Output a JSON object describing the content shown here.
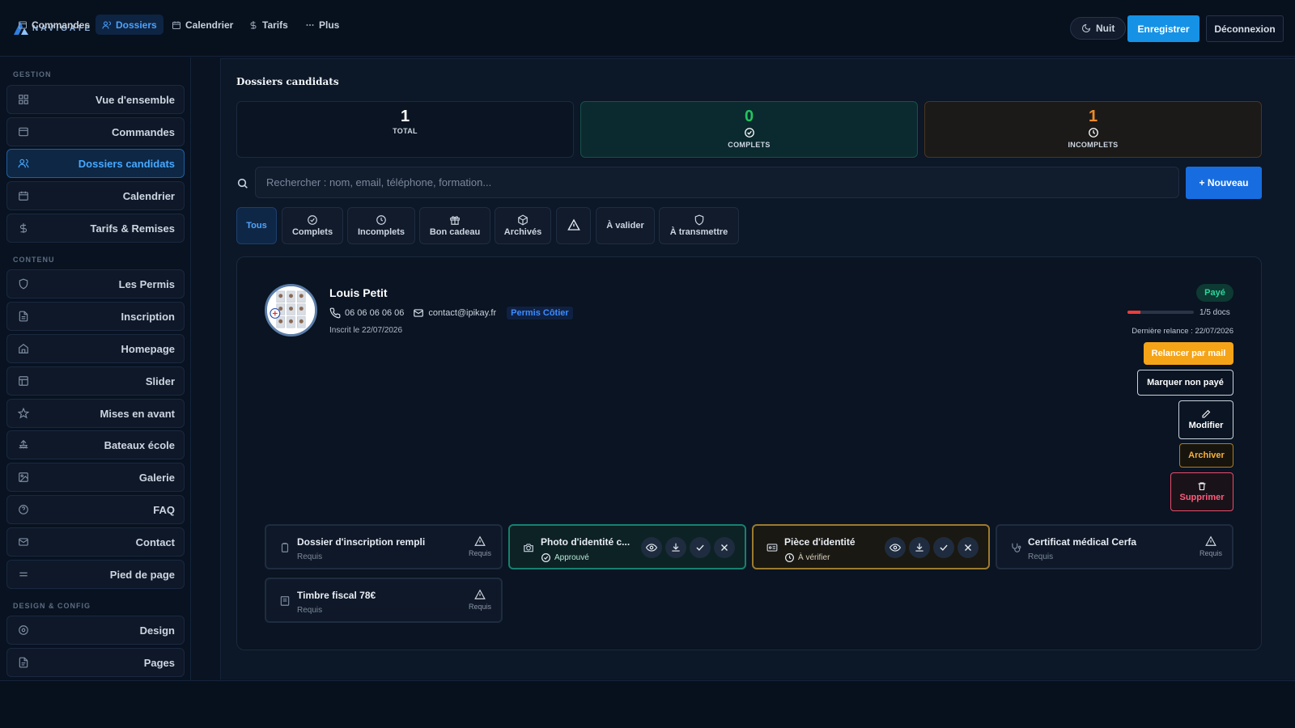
{
  "app": {
    "logo_text": "NAVIGATE"
  },
  "header": {
    "theme_label": "Nuit",
    "save_label": "Enregistrer",
    "logout_label": "Déconnexion"
  },
  "sidebar": {
    "sections": {
      "gestion": "GESTION",
      "contenu": "CONTENU",
      "design": "DESIGN & CONFIG"
    },
    "items": [
      {
        "label": "Vue d'ensemble",
        "icon": "grid-icon"
      },
      {
        "label": "Commandes",
        "icon": "box-icon"
      },
      {
        "label": "Dossiers candidats",
        "icon": "users-icon",
        "active": true
      },
      {
        "label": "Calendrier",
        "icon": "calendar-icon"
      },
      {
        "label": "Tarifs & Remises",
        "icon": "dollar-icon"
      },
      {
        "label": "Les Permis",
        "icon": "shield-icon"
      },
      {
        "label": "Inscription",
        "icon": "file-icon"
      },
      {
        "label": "Homepage",
        "icon": "home-icon"
      },
      {
        "label": "Slider",
        "icon": "layout-icon"
      },
      {
        "label": "Mises en avant",
        "icon": "star-icon"
      },
      {
        "label": "Bateaux école",
        "icon": "ship-icon"
      },
      {
        "label": "Galerie",
        "icon": "image-icon"
      },
      {
        "label": "FAQ",
        "icon": "help-icon"
      },
      {
        "label": "Contact",
        "icon": "mail-icon"
      },
      {
        "label": "Pied de page",
        "icon": "menu-icon"
      },
      {
        "label": "Design",
        "icon": "palette-icon"
      },
      {
        "label": "Pages",
        "icon": "page-icon"
      }
    ]
  },
  "main": {
    "title": "Dossiers candidats",
    "stats": {
      "total": {
        "value": "1",
        "label": "TOTAL"
      },
      "complets": {
        "value": "0",
        "label": "COMPLETS",
        "color": "#22c55e"
      },
      "incomplets": {
        "value": "1",
        "label": "INCOMPLETS",
        "color": "#f08b26"
      }
    },
    "search": {
      "placeholder": "Rechercher : nom, email, téléphone, formation...",
      "value": ""
    },
    "new_button": "+ Nouveau",
    "filters": [
      "Tous",
      "Complets",
      "Incomplets",
      "Bon cadeau",
      "Archivés",
      "",
      "À valider",
      "À transmettre"
    ],
    "candidate": {
      "name": "Louis Petit",
      "phone": "06 06 06 06 06",
      "email": "contact@ipikay.fr",
      "permis": "Permis Côtier",
      "registered": "Inscrit le 22/07/2026",
      "payment_status": "Payé",
      "docs_progress": 0.2,
      "docs_count": "1/5 docs",
      "last_reminder": "Dernière relance : 22/07/2026",
      "actions": {
        "remind": "Relancer par mail",
        "mark_unpaid": "Marquer non payé",
        "edit": "Modifier",
        "archive": "Archiver",
        "delete": "Supprimer"
      },
      "documents": [
        {
          "title": "Dossier d'inscription rempli",
          "status": "Requis",
          "badge": "Requis"
        },
        {
          "title": "Photo d'identité c...",
          "status": "Approuvé"
        },
        {
          "title": "Pièce d'identité",
          "status": "À vérifier"
        },
        {
          "title": "Certificat médical Cerfa",
          "status": "Requis",
          "badge": "Requis"
        },
        {
          "title": "Timbre fiscal 78€",
          "status": "Requis",
          "badge": "Requis"
        }
      ]
    }
  },
  "bottom_nav": [
    {
      "label": "Commandes"
    },
    {
      "label": "Dossiers",
      "active": true
    },
    {
      "label": "Calendrier"
    },
    {
      "label": "Tarifs"
    },
    {
      "label": "Plus"
    }
  ],
  "colors": {
    "accent": "#1592e6",
    "primary": "#176de0",
    "warning": "#f5a418",
    "danger": "#ff5c7a",
    "success": "#2fd49b"
  }
}
